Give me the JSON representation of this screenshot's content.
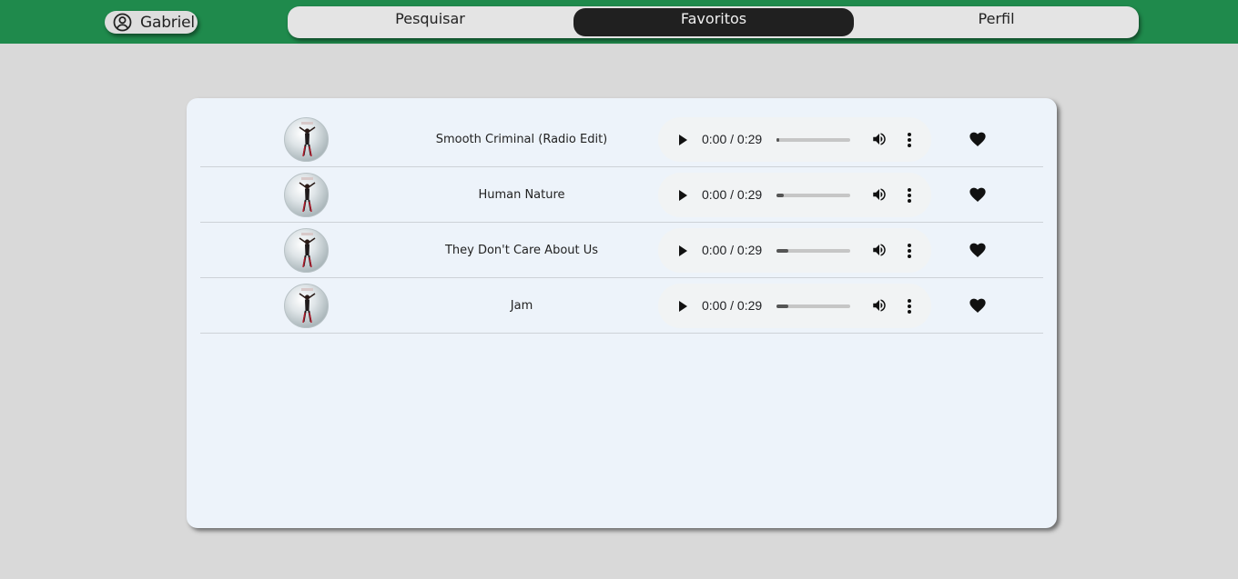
{
  "user": {
    "name": "Gabriel",
    "icon": "user-circle-icon"
  },
  "nav": {
    "tabs": [
      {
        "label": "Pesquisar",
        "active": false
      },
      {
        "label": "Favoritos",
        "active": true
      },
      {
        "label": "Perfil",
        "active": false
      }
    ]
  },
  "favorites": {
    "tracks": [
      {
        "title": "Smooth Criminal (Radio Edit)",
        "time": "0:00 / 0:29",
        "buffered": 0.04
      },
      {
        "title": "Human Nature",
        "time": "0:00 / 0:29",
        "buffered": 0.1
      },
      {
        "title": "They Don't Care About Us",
        "time": "0:00 / 0:29",
        "buffered": 0.16
      },
      {
        "title": "Jam",
        "time": "0:00 / 0:29",
        "buffered": 0.16
      }
    ]
  },
  "colors": {
    "header": "#1f8a4c",
    "page_background": "#d9d9d9",
    "panel": "#edf3fa",
    "active_tab": "#202020"
  }
}
